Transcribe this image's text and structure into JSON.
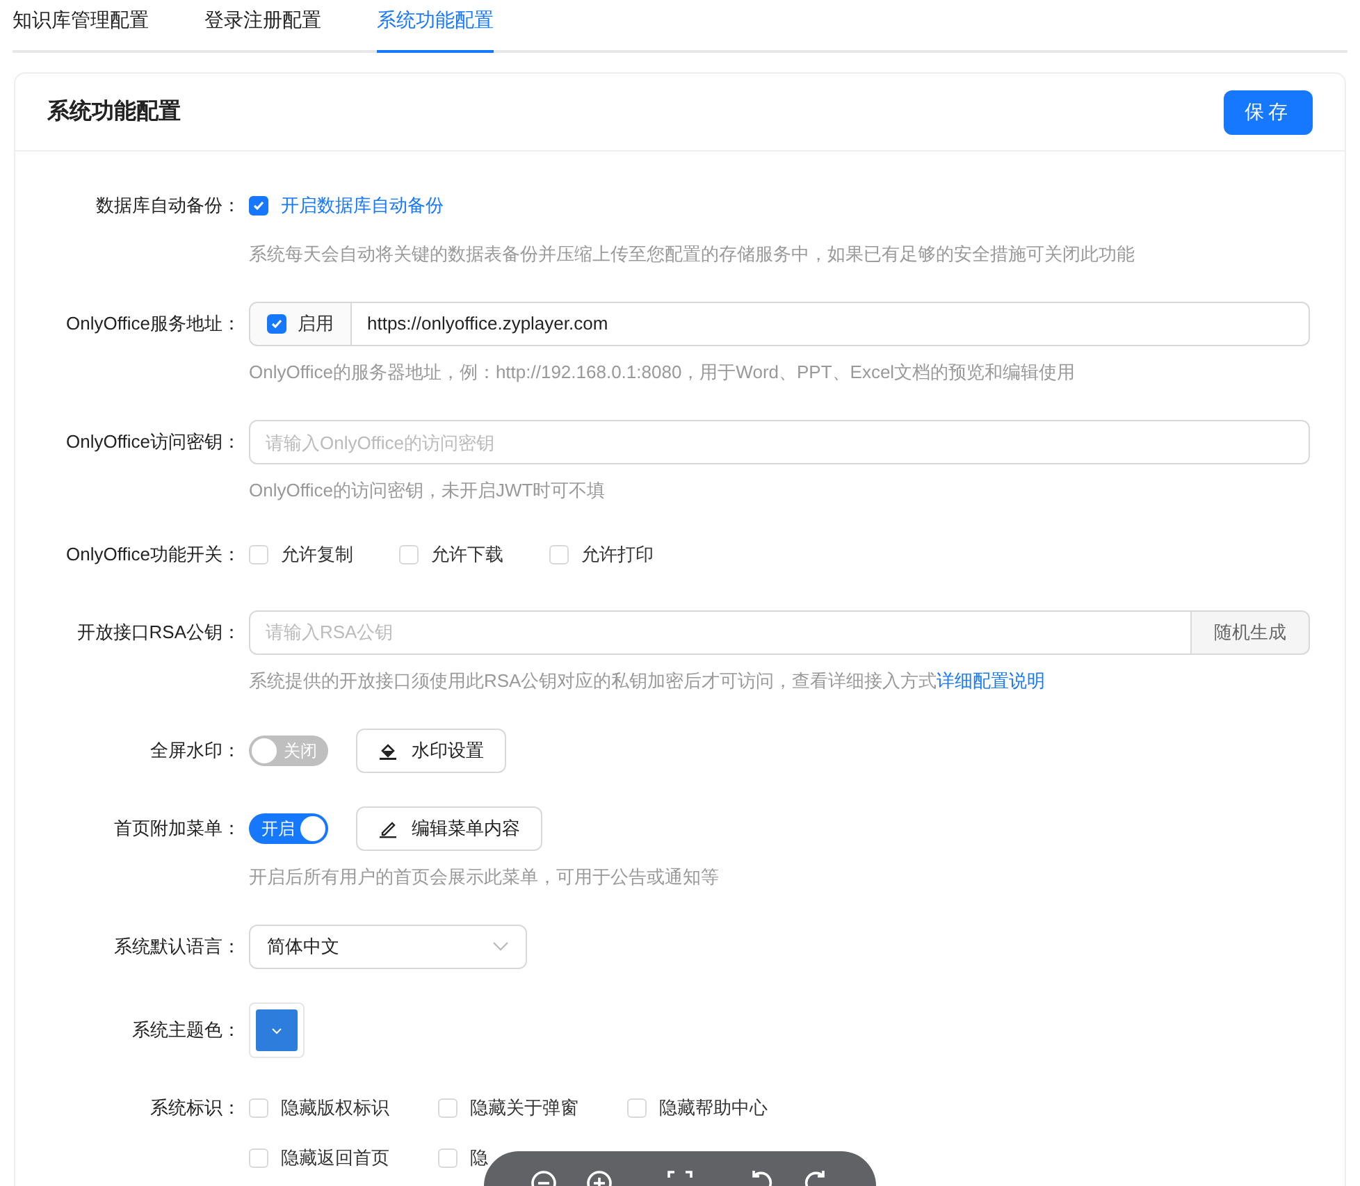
{
  "tabs": [
    {
      "label": "知识库管理配置",
      "selected": false
    },
    {
      "label": "登录注册配置",
      "selected": false
    },
    {
      "label": "系统功能配置",
      "selected": true
    }
  ],
  "card": {
    "title": "系统功能配置",
    "save_button": "保存"
  },
  "form": [
    {
      "kind": "checkbox",
      "label": "数据库自动备份：",
      "option": {
        "label": "开启数据库自动备份",
        "checked": true
      },
      "hint": "系统每天会自动将关键的数据表备份并压缩上传至您配置的存储服务中，如果已有足够的安全措施可关闭此功能"
    },
    {
      "kind": "addon_input",
      "label": "OnlyOffice服务地址：",
      "option": {
        "label": "启用",
        "checked": true
      },
      "value": "https://onlyoffice.zyplayer.com",
      "hint": "OnlyOffice的服务器地址，例：http://192.168.0.1:8080，用于Word、PPT、Excel文档的预览和编辑使用"
    },
    {
      "kind": "input",
      "label": "OnlyOffice访问密钥：",
      "placeholder": "请输入OnlyOffice的访问密钥",
      "hint": "OnlyOffice的访问密钥，未开启JWT时可不填"
    },
    {
      "kind": "checkbox_group",
      "label": "OnlyOffice功能开关：",
      "options": [
        {
          "label": "允许复制",
          "checked": false
        },
        {
          "label": "允许下载",
          "checked": false
        },
        {
          "label": "允许打印",
          "checked": false
        }
      ]
    },
    {
      "kind": "input_button",
      "label": "开放接口RSA公钥：",
      "placeholder": "请输入RSA公钥",
      "button": "随机生成",
      "hint": "系统提供的开放接口须使用此RSA公钥对应的私钥加密后才可访问，查看详细接入方式",
      "hint_link": "详细配置说明"
    },
    {
      "kind": "switch",
      "label": "全屏水印：",
      "on": false,
      "switch_text": "关闭",
      "button": {
        "kind": "paint",
        "label": "水印设置"
      }
    },
    {
      "kind": "switch",
      "label": "首页附加菜单：",
      "on": true,
      "switch_text": "开启",
      "button": {
        "kind": "edit",
        "label": "编辑菜单内容"
      },
      "hint": "开启后所有用户的首页会展示此菜单，可用于公告或通知等"
    },
    {
      "kind": "select",
      "label": "系统默认语言：",
      "value": "简体中文"
    },
    {
      "kind": "color",
      "label": "系统主题色：",
      "color": "#2d7ddc"
    },
    {
      "kind": "checkbox_group",
      "label": "系统标识：",
      "options": [
        {
          "label": "隐藏版权标识",
          "checked": false
        },
        {
          "label": "隐藏关于弹窗",
          "checked": false
        },
        {
          "label": "隐藏帮助中心",
          "checked": false
        },
        {
          "label": "隐藏返回首页",
          "checked": false
        },
        {
          "label": "隐",
          "checked": false
        }
      ]
    }
  ]
}
